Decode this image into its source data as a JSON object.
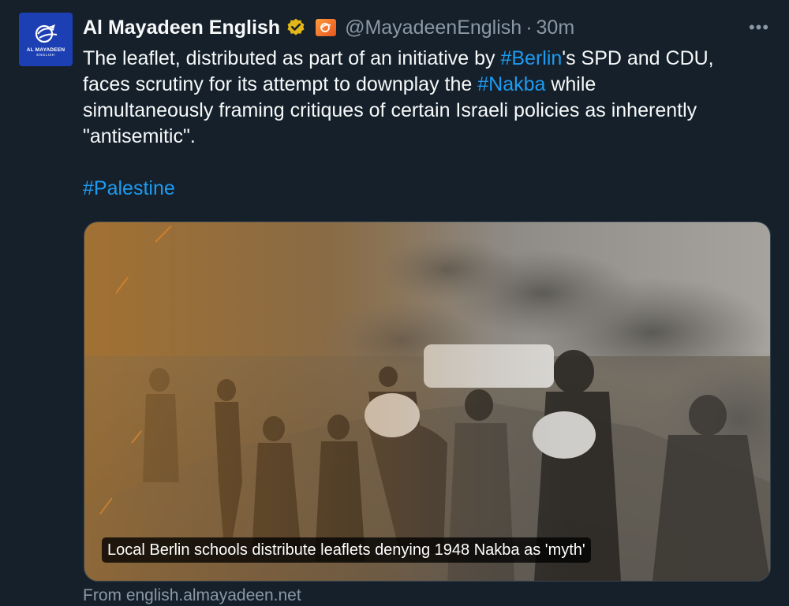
{
  "author": {
    "display_name": "Al Mayadeen English",
    "handle": "@MayadeenEnglish",
    "time": "30m",
    "avatar_text": "AL MAYADEEN",
    "avatar_subtext": "ENGLISH",
    "verified_icon": "gold-verified-badge",
    "affiliate_icon": "al-mayadeen-affiliate-logo"
  },
  "tweet": {
    "line1_pre": "The leaflet, distributed as part of an initiative by ",
    "line1_tag": "#Berlin",
    "line1_post": "'s SPD and CDU,",
    "line2_pre": "faces scrutiny for its attempt to downplay the ",
    "line2_tag": "#Nakba",
    "line2_post": " while",
    "line3": "simultaneously framing critiques of certain Israeli policies as inherently",
    "line4": "\"antisemitic\".",
    "hashtag_line": "#Palestine"
  },
  "card": {
    "caption": "Local Berlin schools distribute leaflets denying 1948 Nakba as 'myth'",
    "source": "From english.almayadeen.net"
  },
  "menu": {
    "more_label": "•••"
  },
  "colors": {
    "background": "#15202b",
    "text": "#f7f9f9",
    "secondary": "#8b98a5",
    "link": "#1d9bf0",
    "avatar_bg": "#1d3fb4",
    "verified": "#e2b719"
  }
}
